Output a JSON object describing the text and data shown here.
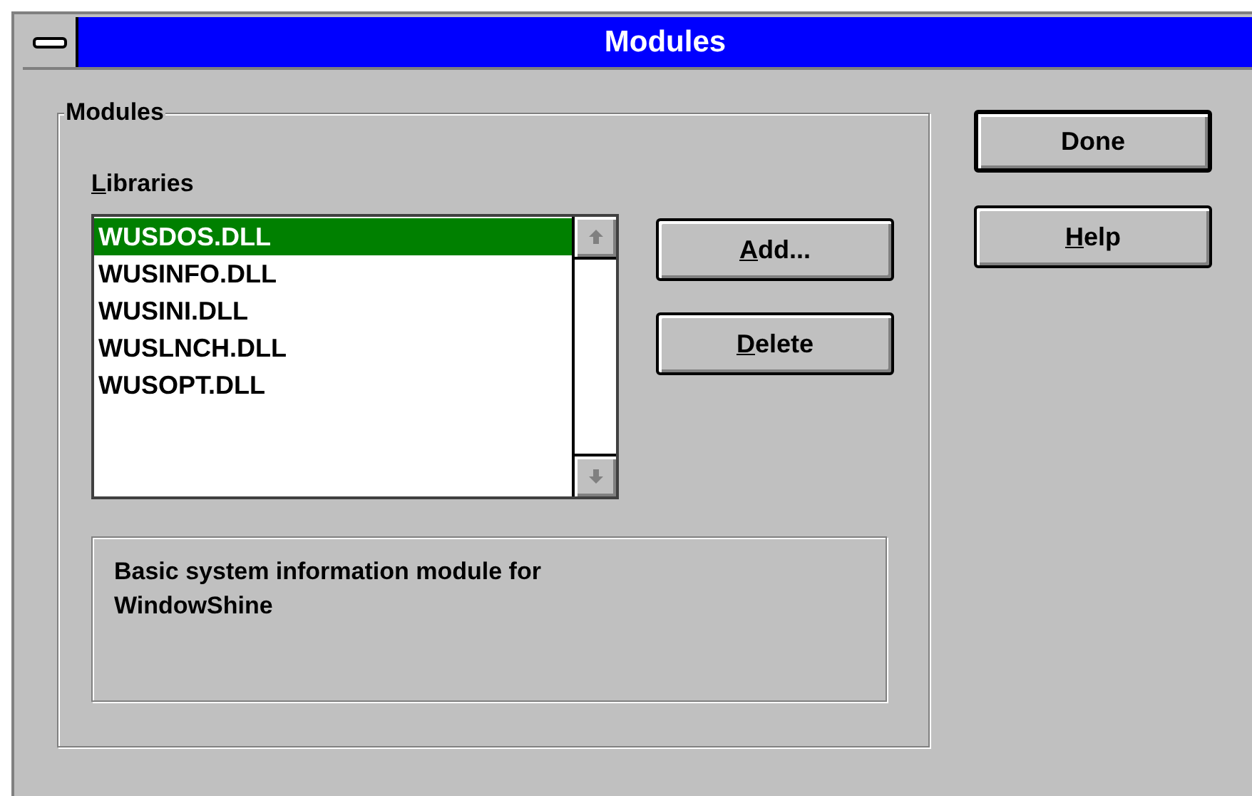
{
  "window": {
    "title": "Modules"
  },
  "group": {
    "label": "Modules",
    "libraries": {
      "label": "Libraries",
      "first_letter_underlined": true,
      "items": [
        {
          "name": "WUSDOS.DLL",
          "selected": true
        },
        {
          "name": "WUSINFO.DLL",
          "selected": false
        },
        {
          "name": "WUSINI.DLL",
          "selected": false
        },
        {
          "name": "WUSLNCH.DLL",
          "selected": false
        },
        {
          "name": "WUSOPT.DLL",
          "selected": false
        }
      ]
    },
    "buttons": [
      {
        "label": "Add...",
        "first_letter_underlined": true
      },
      {
        "label": "Delete",
        "first_letter_underlined": true
      }
    ],
    "description": "Basic system information module for WindowShine"
  },
  "buttons": [
    {
      "label": "Done",
      "first_letter_underlined": false,
      "default": true
    },
    {
      "label": "Help",
      "first_letter_underlined": true,
      "default": false
    }
  ]
}
